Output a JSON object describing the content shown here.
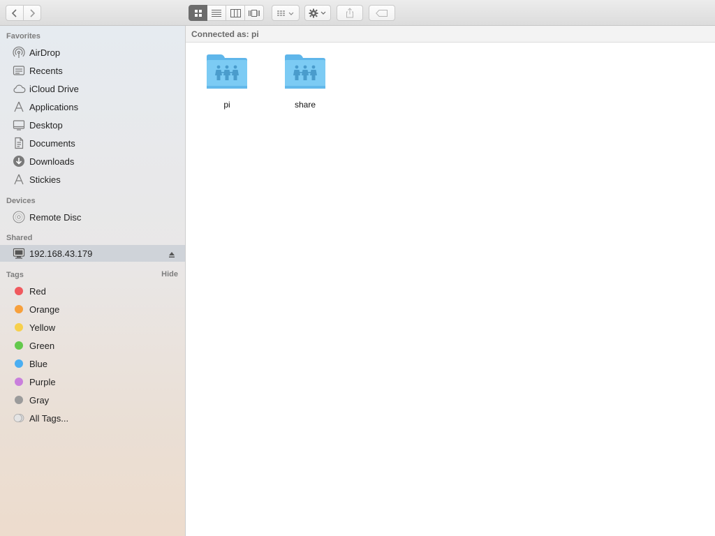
{
  "window": {
    "connected_label": "Connected as: pi"
  },
  "toolbar": {
    "back_icon": "chevron-left-icon",
    "forward_icon": "chevron-right-icon",
    "view_modes": [
      "icon-view",
      "list-view",
      "column-view",
      "cover-flow-view"
    ],
    "active_view": "icon-view"
  },
  "sidebar": {
    "favorites_title": "Favorites",
    "favorites": [
      {
        "label": "AirDrop",
        "icon": "airdrop-icon"
      },
      {
        "label": "Recents",
        "icon": "recents-icon"
      },
      {
        "label": "iCloud Drive",
        "icon": "cloud-icon"
      },
      {
        "label": "Applications",
        "icon": "applications-icon"
      },
      {
        "label": "Desktop",
        "icon": "desktop-icon"
      },
      {
        "label": "Documents",
        "icon": "documents-icon"
      },
      {
        "label": "Downloads",
        "icon": "downloads-icon"
      },
      {
        "label": "Stickies",
        "icon": "applications-icon"
      }
    ],
    "devices_title": "Devices",
    "devices": [
      {
        "label": "Remote Disc",
        "icon": "disc-icon"
      }
    ],
    "shared_title": "Shared",
    "shared": [
      {
        "label": "192.168.43.179",
        "icon": "server-icon",
        "selected": true
      }
    ],
    "tags_title": "Tags",
    "tags_hide": "Hide",
    "tags": [
      {
        "label": "Red",
        "color": "#f0595e"
      },
      {
        "label": "Orange",
        "color": "#f7a03c"
      },
      {
        "label": "Yellow",
        "color": "#f7d04c"
      },
      {
        "label": "Green",
        "color": "#63c94c"
      },
      {
        "label": "Blue",
        "color": "#4aaef2"
      },
      {
        "label": "Purple",
        "color": "#c97fdc"
      },
      {
        "label": "Gray",
        "color": "#9b9b9b"
      },
      {
        "label": "All Tags...",
        "color": "all"
      }
    ]
  },
  "content": {
    "folders": [
      {
        "label": "pi",
        "icon": "shared-folder-icon"
      },
      {
        "label": "share",
        "icon": "shared-folder-icon"
      }
    ]
  },
  "colors": {
    "folder_blue": "#6dc3f2",
    "selection": "#cfd3d9"
  }
}
